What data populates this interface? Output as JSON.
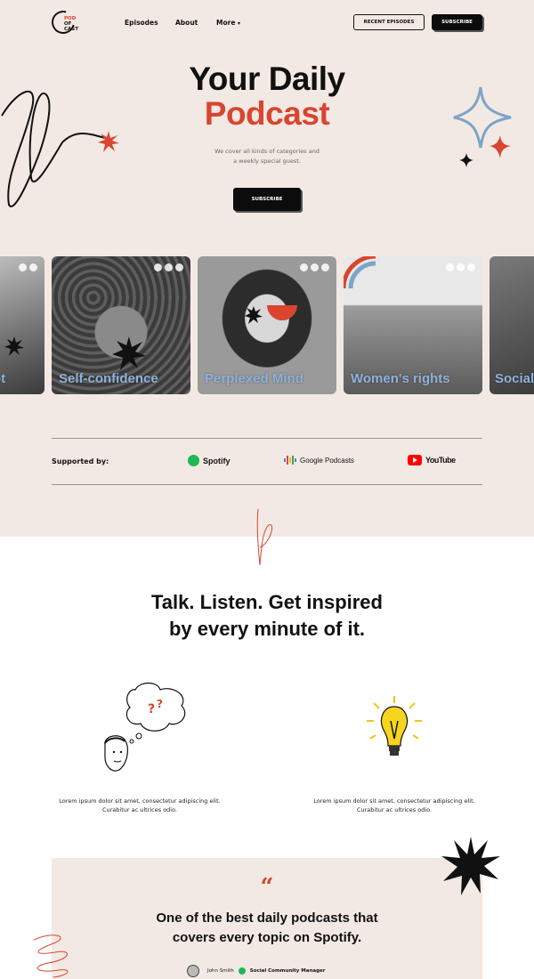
{
  "header": {
    "logo_lines": [
      "POD",
      "OF",
      "CAST"
    ],
    "nav": [
      "Episodes",
      "About",
      "More"
    ],
    "recent_label": "RECENT EPISODES",
    "subscribe_label": "SUBSCRIBE"
  },
  "hero": {
    "title_line1": "Your Daily",
    "title_line2": "Podcast",
    "subtitle_line1": "We cover all kinds of categories and",
    "subtitle_line2": "a weekly special guest.",
    "button_label": "SUBSCRIBE"
  },
  "cards": [
    {
      "label": "ot"
    },
    {
      "label": "Self-confidence"
    },
    {
      "label": "Perplexed Mind"
    },
    {
      "label": "Women's rights"
    },
    {
      "label": "Social"
    }
  ],
  "supported": {
    "label": "Supported by:",
    "brands": [
      "Spotify",
      "Google Podcasts",
      "YouTube"
    ]
  },
  "section": {
    "title_line1": "Talk. Listen. Get inspired",
    "title_line2": "by every minute of it.",
    "features": [
      {
        "line1": "Lorem ipsum dolor sit amet, consectetur adipiscing elit.",
        "line2": "Curabitur ac ultrices odio."
      },
      {
        "line1": "Lorem ipsum dolor sit amet, consectetur adipiscing elit.",
        "line2": "Curabitur ac ultrices odio."
      }
    ]
  },
  "testimonial": {
    "quote_mark": "“",
    "line1": "One of the best daily podcasts that",
    "line2": "covers every topic on Spotify.",
    "author": "John Smith",
    "role": "Social Community Manager"
  },
  "colors": {
    "accent": "#d9452f",
    "background": "#f3e9e4",
    "blue": "#8fb1d9"
  }
}
